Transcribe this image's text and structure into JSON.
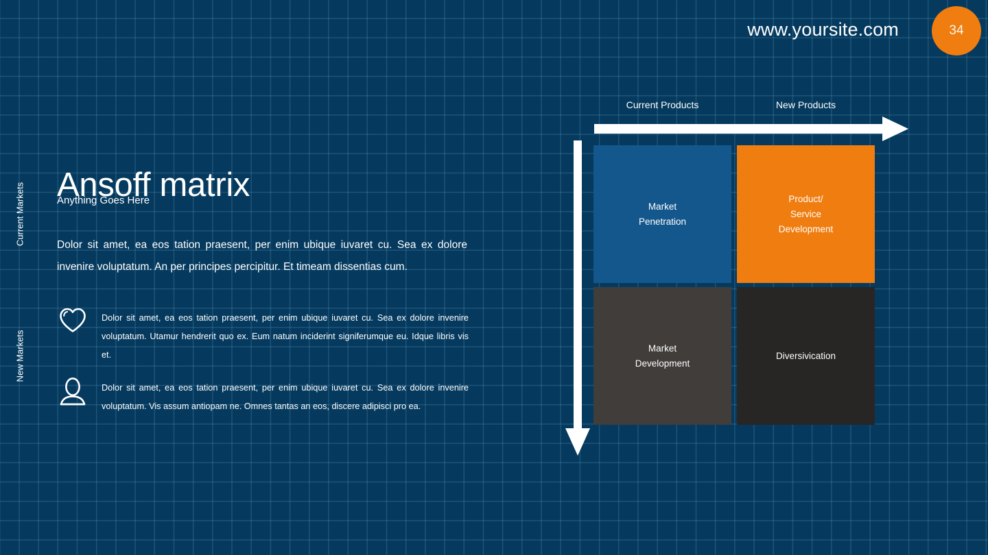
{
  "header": {
    "site_url": "www.yoursite.com",
    "page_number": "34"
  },
  "content": {
    "title": "Ansoff matrix",
    "subtitle": "Anything Goes Here",
    "lead_paragraph": "Dolor sit amet, ea eos tation praesent, per enim ubique iuvaret cu. Sea ex dolore invenire voluptatum. An per principes percipitur. Et timeam dissentias cum.",
    "features": [
      {
        "icon": "heart-icon",
        "text": "Dolor sit amet, ea eos tation praesent, per enim ubique iuvaret cu. Sea ex dolore invenire voluptatum. Utamur hendrerit quo ex. Eum natum inciderint signiferumque eu. Idque libris vis et."
      },
      {
        "icon": "person-icon",
        "text": "Dolor sit amet, ea eos tation praesent, per enim ubique iuvaret cu. Sea ex dolore invenire voluptatum. Vis assum antiopam ne. Omnes tantas an eos, discere adipisci pro ea."
      }
    ]
  },
  "matrix": {
    "column_headers": [
      "Current Products",
      "New Products"
    ],
    "row_headers": [
      "Current Markets",
      "New Markets"
    ],
    "quadrants": [
      {
        "label": "Market\nPenetration",
        "color": "#14578c"
      },
      {
        "label": "Product/\nService\nDevelopment",
        "color": "#f07d10"
      },
      {
        "label": "Market\nDevelopment",
        "color": "#403d3b"
      },
      {
        "label": "Diversivication",
        "color": "#282624"
      }
    ],
    "axis_arrows": {
      "horizontal": "right-arrow-icon",
      "vertical": "down-arrow-icon"
    }
  },
  "theme": {
    "background": "#053a5e",
    "grid_line": "#4a80a8",
    "accent_orange": "#f07d10",
    "accent_blue": "#14578c"
  }
}
